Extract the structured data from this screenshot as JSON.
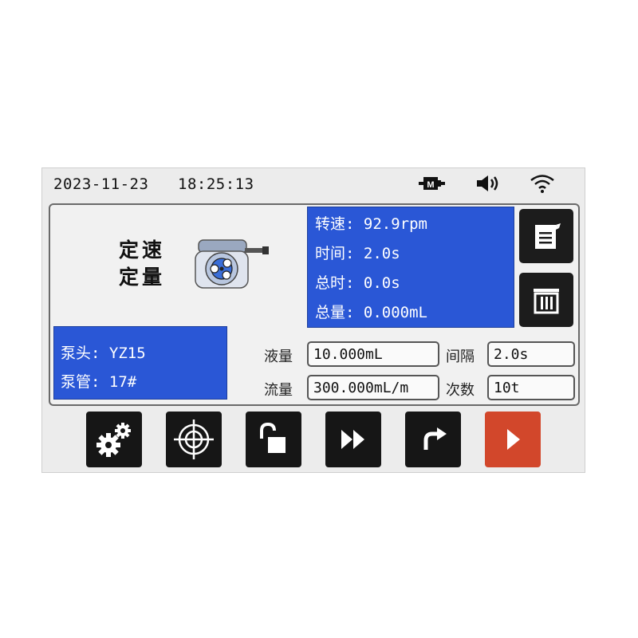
{
  "status": {
    "date": "2023-11-23",
    "time": "18:25:13",
    "icons": [
      "motor-icon",
      "speaker-icon",
      "wifi-icon"
    ],
    "motor_badge": "M"
  },
  "mode": {
    "line1": "定速",
    "line2": "定量"
  },
  "info": {
    "speed_label": "转速:",
    "speed_value": "92.9rpm",
    "time_label": "时间:",
    "time_value": "2.0s",
    "total_time_label": "总时:",
    "total_time_value": "0.0s",
    "total_volume_label": "总量:",
    "total_volume_value": "0.000mL"
  },
  "pump": {
    "head_label": "泵头:",
    "head_value": "YZ15",
    "tube_label": "泵管:",
    "tube_value": "17#"
  },
  "params": {
    "volume_label": "液量",
    "volume_value": "10.000mL",
    "interval_label": "间隔",
    "interval_value": "2.0s",
    "flow_label": "流量",
    "flow_value": "300.000mL/m",
    "count_label": "次数",
    "count_value": "10t"
  },
  "toolbar": {
    "buttons": [
      "settings-gears-icon",
      "calibrate-target-icon",
      "unlock-icon",
      "fast-forward-icon",
      "reverse-icon",
      "play-icon"
    ]
  },
  "colors": {
    "info_bg": "#2a57d6",
    "button_bg": "#161616",
    "play_button_bg": "#d2472b",
    "screen_bg": "#ececec"
  }
}
